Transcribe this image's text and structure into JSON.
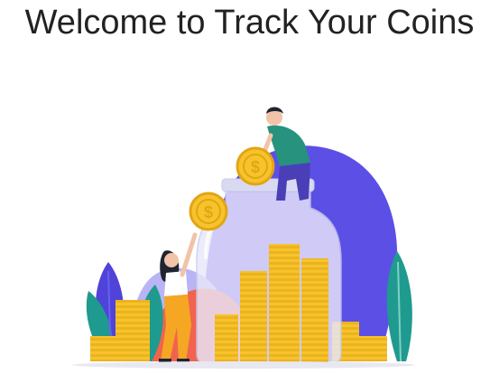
{
  "page": {
    "title": "Welcome to Track Your Coins"
  },
  "illustration": {
    "subject": "people depositing coins into a savings jar",
    "colors": {
      "blob_primary": "#5B4FE6",
      "blob_light": "#B9B4F5",
      "teal": "#1F9A8E",
      "coral": "#F0644F",
      "coin": "#F6C32C",
      "coin_dark": "#E3A513",
      "jar_glass": "#E9E7FA",
      "jar_lid": "#D9DAF2",
      "skin": "#F1C3A8",
      "hair": "#1F2430",
      "shirt_green": "#27927E",
      "pants_purple": "#4B3FB8",
      "shirt_white": "#FFFFFF",
      "pants_yellow": "#F5A623"
    },
    "icons": [
      "coin-icon",
      "dollar-sign-icon",
      "jar-icon",
      "plant-icon"
    ]
  }
}
